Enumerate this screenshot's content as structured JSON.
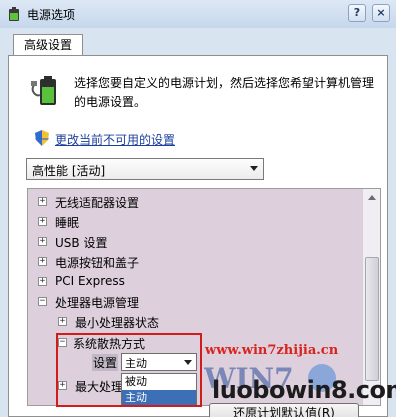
{
  "window": {
    "title": "电源选项",
    "help_glyph": "?",
    "close_glyph": "×"
  },
  "tab": {
    "label": "高级设置"
  },
  "intro": {
    "icon": "battery-plug-icon",
    "text": "选择您要自定义的电源计划，然后选择您希望计算机管理的电源设置。"
  },
  "change_link": {
    "icon": "uac-shield-icon",
    "label": "更改当前不可用的设置"
  },
  "plan_select": {
    "value": "高性能 [活动]"
  },
  "tree": {
    "items": [
      {
        "label": "无线适配器设置",
        "expander": "+"
      },
      {
        "label": "睡眠",
        "expander": "+"
      },
      {
        "label": "USB 设置",
        "expander": "+"
      },
      {
        "label": "电源按钮和盖子",
        "expander": "+"
      },
      {
        "label": "PCI Express",
        "expander": "+"
      },
      {
        "label": "处理器电源管理",
        "expander": "−"
      },
      {
        "label": "最小处理器状态",
        "expander": "+"
      },
      {
        "label": "系统散热方式",
        "expander": "−"
      },
      {
        "label": "最大处理",
        "expander": "+"
      }
    ],
    "setting_label": "设置",
    "setting_value": "主动",
    "dropdown_options": [
      "被动",
      "主动"
    ],
    "dropdown_selected_index": 1
  },
  "restore_button": {
    "label": "还原计划默认值(R)"
  },
  "watermarks": {
    "top": "www.win7zhijia.cn",
    "bottom": "luobowin8.com"
  },
  "colors": {
    "tree_background": "#ddd0dc",
    "highlight_border": "#d21c1c",
    "link": "#1c3f9e",
    "dropdown_selected": "#3d6fb6"
  }
}
